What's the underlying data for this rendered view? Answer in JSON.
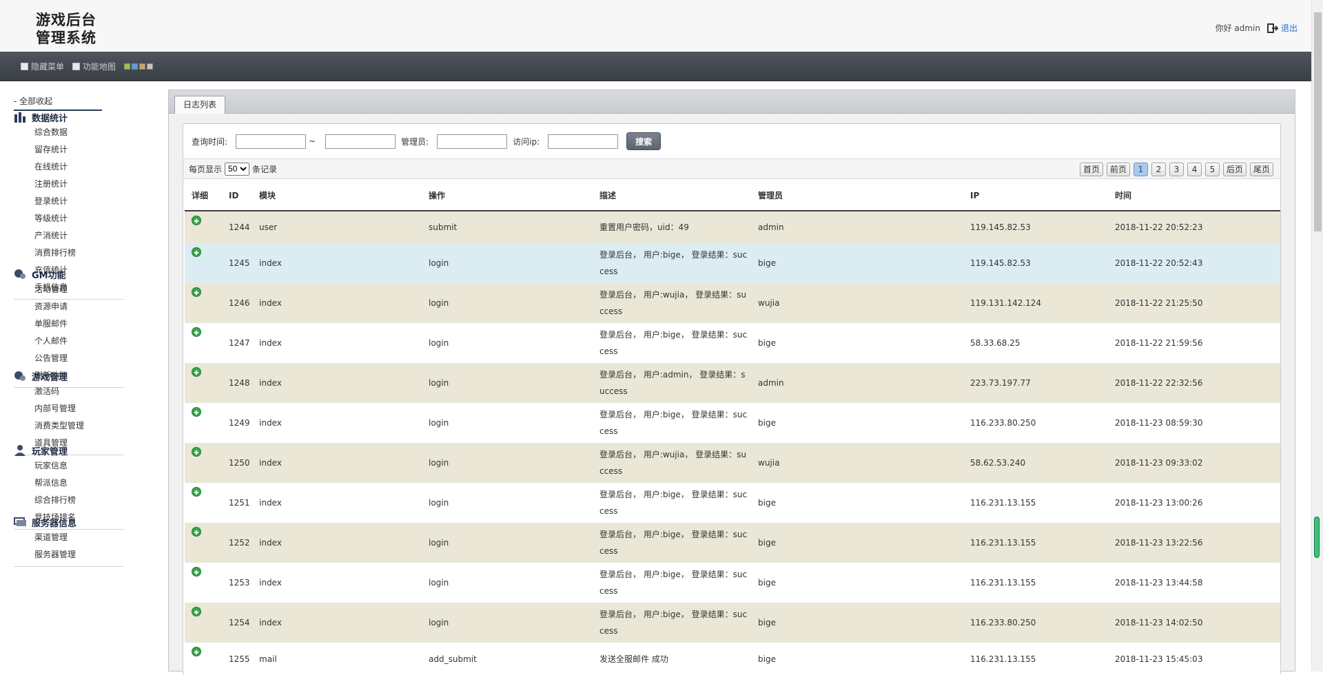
{
  "header": {
    "logo_line1": "游戏后台",
    "logo_line2": "管理系统",
    "greeting": "你好 admin",
    "logout": "退出"
  },
  "toolbar": {
    "hide_menu": "隐藏菜单",
    "function_map": "功能地图",
    "swatches": [
      "#9ac43c",
      "#5aa0d8",
      "#c8a660",
      "#c4c4c4"
    ]
  },
  "sidebar": {
    "collapse_all": "- 全部收起",
    "groups": [
      {
        "title": "数据统计",
        "icon": "bar-chart-icon",
        "items": [
          "综合数据",
          "留存统计",
          "在线统计",
          "注册统计",
          "登录统计",
          "等级统计",
          "产消统计",
          "消费排行榜",
          "充值统计",
          "手机信息"
        ]
      },
      {
        "title": "GM功能",
        "icon": "gear-icon",
        "items": [
          "活动管理",
          "资源申请",
          "单服邮件",
          "个人邮件",
          "公告管理",
          "刷新功能"
        ]
      },
      {
        "title": "游戏管理",
        "icon": "gear-icon",
        "items": [
          "激活码",
          "内部号管理",
          "消费类型管理",
          "道具管理"
        ]
      },
      {
        "title": "玩家管理",
        "icon": "user-icon",
        "items": [
          "玩家信息",
          "帮派信息",
          "综合排行榜",
          "竞技场排名"
        ]
      },
      {
        "title": "服务器信息",
        "icon": "server-icon",
        "items": [
          "渠道管理",
          "服务器管理"
        ]
      }
    ]
  },
  "tab": {
    "label": "日志列表"
  },
  "search": {
    "time_label": "查询时间:",
    "tilde": "~",
    "admin_label": "管理员:",
    "ip_label": "访问ip:",
    "button": "搜索",
    "time_from": "",
    "time_to": "",
    "admin_value": "",
    "ip_value": ""
  },
  "paging": {
    "per_page_prefix": "每页显示",
    "per_page_value": "50",
    "per_page_suffix": "条记录",
    "first": "首页",
    "prev": "前页",
    "pages": [
      "1",
      "2",
      "3",
      "4",
      "5"
    ],
    "active_page": "1",
    "next": "后页",
    "last": "尾页"
  },
  "table": {
    "headers": [
      "详细",
      "ID",
      "模块",
      "操作",
      "描述",
      "管理员",
      "IP",
      "时间"
    ],
    "rows": [
      {
        "id": "1244",
        "module": "user",
        "action": "submit",
        "desc": "重置用户密码，uid：49",
        "admin": "admin",
        "ip": "119.145.82.53",
        "time": "2018-11-22 20:52:23"
      },
      {
        "id": "1245",
        "module": "index",
        "action": "login",
        "desc": "登录后台， 用户:bige， 登录结果：success",
        "admin": "bige",
        "ip": "119.145.82.53",
        "time": "2018-11-22 20:52:43"
      },
      {
        "id": "1246",
        "module": "index",
        "action": "login",
        "desc": "登录后台， 用户:wujia， 登录结果：success",
        "admin": "wujia",
        "ip": "119.131.142.124",
        "time": "2018-11-22 21:25:50"
      },
      {
        "id": "1247",
        "module": "index",
        "action": "login",
        "desc": "登录后台， 用户:bige， 登录结果：success",
        "admin": "bige",
        "ip": "58.33.68.25",
        "time": "2018-11-22 21:59:56"
      },
      {
        "id": "1248",
        "module": "index",
        "action": "login",
        "desc": "登录后台， 用户:admin， 登录结果：success",
        "admin": "admin",
        "ip": "223.73.197.77",
        "time": "2018-11-22 22:32:56"
      },
      {
        "id": "1249",
        "module": "index",
        "action": "login",
        "desc": "登录后台， 用户:bige， 登录结果：success",
        "admin": "bige",
        "ip": "116.233.80.250",
        "time": "2018-11-23 08:59:30"
      },
      {
        "id": "1250",
        "module": "index",
        "action": "login",
        "desc": "登录后台， 用户:wujia， 登录结果：success",
        "admin": "wujia",
        "ip": "58.62.53.240",
        "time": "2018-11-23 09:33:02"
      },
      {
        "id": "1251",
        "module": "index",
        "action": "login",
        "desc": "登录后台， 用户:bige， 登录结果：success",
        "admin": "bige",
        "ip": "116.231.13.155",
        "time": "2018-11-23 13:00:26"
      },
      {
        "id": "1252",
        "module": "index",
        "action": "login",
        "desc": "登录后台， 用户:bige， 登录结果：success",
        "admin": "bige",
        "ip": "116.231.13.155",
        "time": "2018-11-23 13:22:56"
      },
      {
        "id": "1253",
        "module": "index",
        "action": "login",
        "desc": "登录后台， 用户:bige， 登录结果：success",
        "admin": "bige",
        "ip": "116.231.13.155",
        "time": "2018-11-23 13:44:58"
      },
      {
        "id": "1254",
        "module": "index",
        "action": "login",
        "desc": "登录后台， 用户:bige， 登录结果：success",
        "admin": "bige",
        "ip": "116.233.80.250",
        "time": "2018-11-23 14:02:50"
      },
      {
        "id": "1255",
        "module": "mail",
        "action": "add_submit",
        "desc": "发送全服邮件 成功",
        "admin": "bige",
        "ip": "116.231.13.155",
        "time": "2018-11-23 15:45:03"
      }
    ]
  }
}
